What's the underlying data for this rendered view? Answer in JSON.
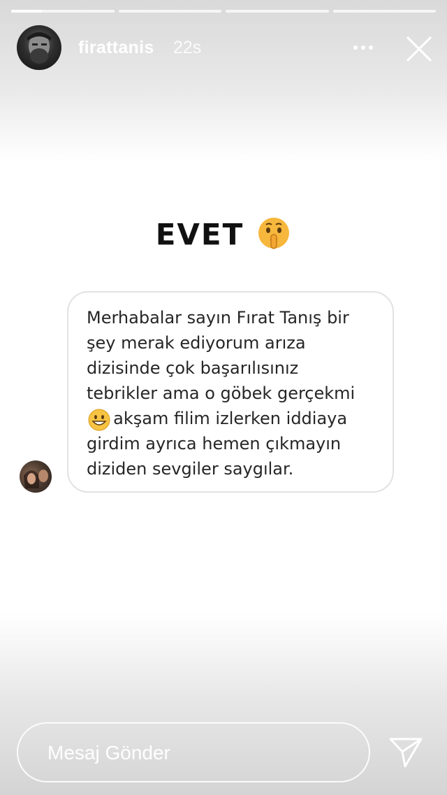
{
  "story": {
    "progress_segments": [
      {
        "state": "active",
        "fill_fraction": 0.3
      },
      {
        "state": "pending",
        "fill_fraction": 0
      },
      {
        "state": "pending",
        "fill_fraction": 0
      },
      {
        "state": "pending",
        "fill_fraction": 0
      }
    ],
    "username": "firattanis",
    "time": "22s"
  },
  "header": {
    "more_icon": "more-horizontal-icon",
    "close_icon": "close-icon"
  },
  "content": {
    "title": "EVET",
    "title_emoji_icon": "shushing-face-emoji",
    "question": "Merhabalar sayın Fırat Tanış bir\nşey merak ediyorum arıza\ndizisinde çok başarılısınız\ntebrikler ama o göbek gerçekmi\n     akşam filim izlerken iddiaya\ngirdim ayrıca hemen çıkmayın\ndiziden sevgiler saygılar.",
    "question_emoji_icon": "grinning-face-emoji"
  },
  "footer": {
    "message_placeholder": "Mesaj Gönder",
    "send_icon": "send-icon"
  },
  "colors": {
    "overlay_text": "#ffffff",
    "card_border": "#e2e2e2",
    "question_text": "#262626"
  }
}
